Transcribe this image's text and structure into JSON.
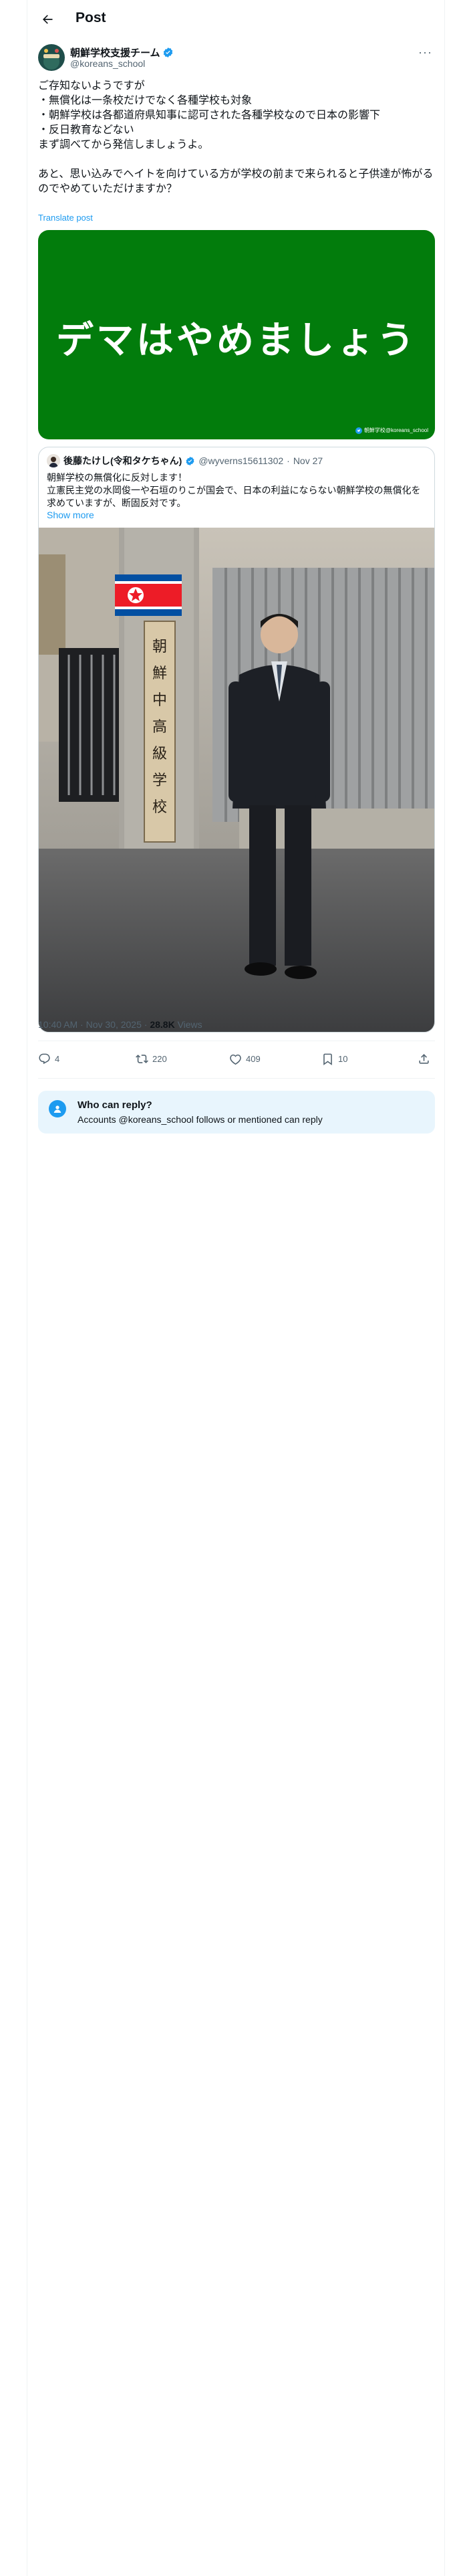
{
  "header": {
    "title": "Post",
    "back_icon": "arrow-left-icon"
  },
  "tweet": {
    "author_name": "朝鮮学校支援チーム",
    "author_handle": "@koreans_school",
    "verified": true,
    "body": "ご存知ないようですが\n・無償化は一条校だけでなく各種学校も対象\n・朝鮮学校は各都道府県知事に認可された各種学校なので日本の影響下\n・反日教育などない\nまず調べてから発信しましょうよ。\n\nあと、思い込みでヘイトを向けている方が学校の前まで来られると子供達が怖がるのでやめていただけますか？",
    "translate_label": "Translate post",
    "image_text": "デマはやめましょう",
    "image_watermark": "朝鮮学校@koreans_school"
  },
  "quoted": {
    "author_name": "後藤たけし(令和タケちゃん)",
    "author_handle": "@wyverns15611302",
    "date": "Nov 27",
    "separator": "·",
    "verified": true,
    "body": "朝鮮学校の無償化に反対します！\n立憲民主党の水岡俊一や石垣のりこが国会で、日本の利益にならない朝鮮学校の無償化を求めていますが、断固反対です。",
    "show_more": "Show more",
    "photo_sign_text": "朝鮮中高級学校"
  },
  "meta": {
    "time": "10:40 AM · Nov 30, 2025 · ",
    "views_count": "28.8K",
    "views_label": " Views"
  },
  "actions": {
    "replies": "4",
    "reposts": "220",
    "likes": "409",
    "bookmarks": "10"
  },
  "reply_restriction": {
    "title": "Who can reply?",
    "subtitle": "Accounts @koreans_school follows or mentioned can reply"
  },
  "colors": {
    "accent": "#1d9bf0",
    "green_card": "#027c0c",
    "reply_bg": "#e8f5fd"
  }
}
